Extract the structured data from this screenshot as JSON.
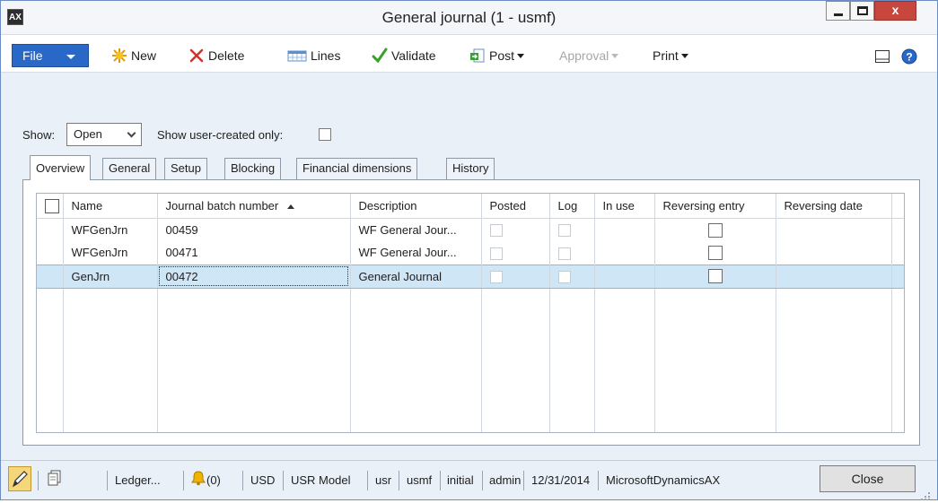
{
  "window": {
    "title": "General journal (1 - usmf)",
    "app_icon": "AX"
  },
  "toolbar": {
    "file": "File",
    "new": "New",
    "delete": "Delete",
    "lines": "Lines",
    "validate": "Validate",
    "post": "Post",
    "approval": "Approval",
    "print": "Print"
  },
  "filters": {
    "show_label": "Show:",
    "show_value": "Open",
    "user_created_label": "Show user-created only:"
  },
  "tabs": [
    "Overview",
    "General",
    "Setup",
    "Blocking",
    "Financial dimensions",
    "History"
  ],
  "grid": {
    "columns": [
      "Name",
      "Journal batch number",
      "Description",
      "Posted",
      "Log",
      "In use",
      "Reversing entry",
      "Reversing date"
    ],
    "rows": [
      {
        "name": "WFGenJrn",
        "batch": "00459",
        "description": "WF General Jour..."
      },
      {
        "name": "WFGenJrn",
        "batch": "00471",
        "description": "WF General Jour..."
      },
      {
        "name": "GenJrn",
        "batch": "00472",
        "description": "General Journal"
      }
    ]
  },
  "statusbar": {
    "ledger": "Ledger...",
    "notifications": "(0)",
    "currency": "USD",
    "model": "USR Model",
    "layer": "usr",
    "company": "usmf",
    "partition": "initial",
    "user": "admin",
    "date": "12/31/2014",
    "aos": "MicrosoftDynamicsAX",
    "close": "Close"
  },
  "colors": {
    "accent": "#2a68c8",
    "selected_row": "#cfe6f7",
    "window_bg": "#e9f0f8",
    "close_red": "#c7463d"
  }
}
